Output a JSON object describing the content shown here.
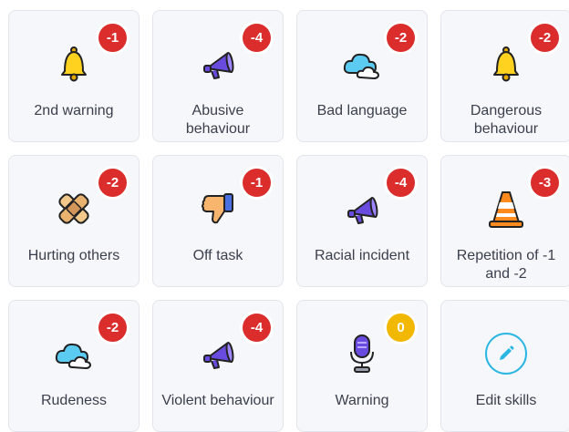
{
  "skills": [
    {
      "label": "2nd warning",
      "points": "-1",
      "icon": "bell-icon"
    },
    {
      "label": "Abusive behaviour",
      "points": "-4",
      "icon": "megaphone-icon"
    },
    {
      "label": "Bad language",
      "points": "-2",
      "icon": "cloud-icon"
    },
    {
      "label": "Dangerous behaviour",
      "points": "-2",
      "icon": "bell-icon"
    },
    {
      "label": "Hurting others",
      "points": "-2",
      "icon": "bandage-icon"
    },
    {
      "label": "Off task",
      "points": "-1",
      "icon": "thumbs-down-icon"
    },
    {
      "label": "Racial incident",
      "points": "-4",
      "icon": "megaphone-icon"
    },
    {
      "label": "Repetition of -1 and -2",
      "points": "-3",
      "icon": "traffic-cone-icon"
    },
    {
      "label": "Rudeness",
      "points": "-2",
      "icon": "cloud-icon"
    },
    {
      "label": "Violent behaviour",
      "points": "-4",
      "icon": "megaphone-icon"
    },
    {
      "label": "Warning",
      "points": "0",
      "icon": "microphone-icon"
    }
  ],
  "edit": {
    "label": "Edit skills",
    "icon": "pencil-icon"
  },
  "colors": {
    "negative_badge": "#dc2d2d",
    "zero_badge": "#f2b800",
    "edit_accent": "#2ab6e3",
    "tile_background": "#f6f7fa"
  }
}
